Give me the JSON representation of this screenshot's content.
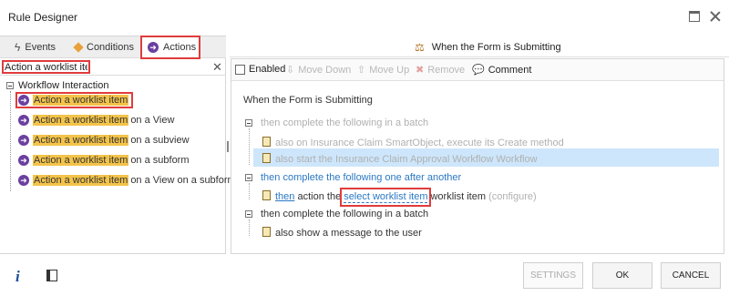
{
  "window": {
    "title": "Rule Designer"
  },
  "left": {
    "tabs": [
      {
        "label": "Events"
      },
      {
        "label": "Conditions"
      },
      {
        "label": "Actions"
      }
    ],
    "search": {
      "value": "Action a worklist item"
    },
    "tree": {
      "root": "Workflow Interaction",
      "items": [
        {
          "match": "Action a worklist item",
          "suffix": ""
        },
        {
          "match": "Action a worklist item",
          "suffix": " on a View"
        },
        {
          "match": "Action a worklist item",
          "suffix": " on a subview"
        },
        {
          "match": "Action a worklist item",
          "suffix": " on a subform"
        },
        {
          "match": "Action a worklist item",
          "suffix": " on a View on a subform"
        }
      ]
    }
  },
  "right": {
    "header": "When the Form is Submitting",
    "toolbar": {
      "enabled": "Enabled",
      "move_down": "Move Down",
      "move_up": "Move Up",
      "remove": "Remove",
      "comment": "Comment"
    },
    "rule": {
      "title": "When the Form is Submitting",
      "batch1": "then complete the following in a batch",
      "batch1_items": [
        "also on Insurance Claim SmartObject, execute its Create method",
        "also start the Insurance Claim Approval Workflow Workflow"
      ],
      "sequence": "then complete the following one after another",
      "action": {
        "then": "then",
        "pre": "action the",
        "configure_link": "select worklist item",
        "post": "worklist item",
        "hint": "(configure)"
      },
      "batch2": "then complete the following in a batch",
      "batch2_items": [
        "also show a message to the user"
      ]
    }
  },
  "footer": {
    "info_icon": "i",
    "settings": "SETTINGS",
    "ok": "OK",
    "cancel": "CANCEL"
  },
  "colors": {
    "highlight": "#f3c34a",
    "annotation_red": "#e03c3c",
    "selection_blue": "#cde6fb",
    "link_blue": "#2b78c5",
    "action_purple": "#6b3fa0"
  }
}
